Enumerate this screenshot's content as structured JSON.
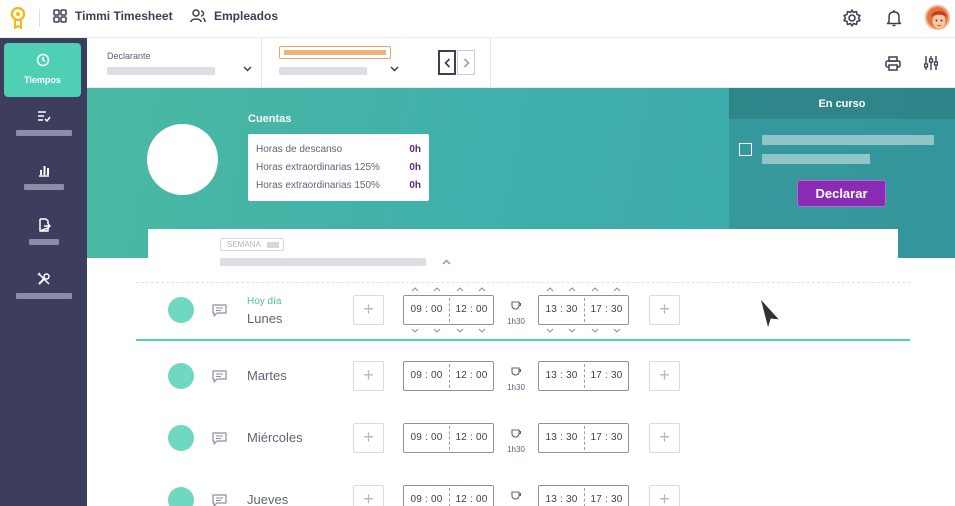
{
  "topbar": {
    "app_name": "Timmi Timesheet",
    "employees_label": "Empleados"
  },
  "sidebar": {
    "items": [
      {
        "label": "Tiempos",
        "icon": "clock-icon",
        "active": true
      },
      {
        "label": "",
        "icon": "list-check-icon"
      },
      {
        "label": "",
        "icon": "bar-chart-icon"
      },
      {
        "label": "",
        "icon": "document-export-icon"
      },
      {
        "label": "",
        "icon": "tools-icon"
      }
    ]
  },
  "filters": {
    "declarante_label": "Declarante"
  },
  "summary": {
    "cuentas_title": "Cuentas",
    "rows": [
      {
        "label": "Horas de descanso",
        "value": "0h"
      },
      {
        "label": "Horas extraordinarias 125%",
        "value": "0h"
      },
      {
        "label": "Horas extraordinarias 150%",
        "value": "0h"
      }
    ]
  },
  "en_curso": {
    "title": "En curso",
    "declare_button": "Declarar"
  },
  "week": {
    "semana_tag": "SEMANA",
    "days": [
      {
        "hoy": "Hoy día",
        "name": "Lunes",
        "am_start": "09 : 00",
        "am_end": "12 : 00",
        "break": "1h30",
        "pm_start": "13 : 30",
        "pm_end": "17 : 30"
      },
      {
        "hoy": "",
        "name": "Martes",
        "am_start": "09 : 00",
        "am_end": "12 : 00",
        "break": "1h30",
        "pm_start": "13 : 30",
        "pm_end": "17 : 30"
      },
      {
        "hoy": "",
        "name": "Miércoles",
        "am_start": "09 : 00",
        "am_end": "12 : 00",
        "break": "1h30",
        "pm_start": "13 : 30",
        "pm_end": "17 : 30"
      },
      {
        "hoy": "",
        "name": "Jueves",
        "am_start": "09 : 00",
        "am_end": "12 : 00",
        "break": "1h30",
        "pm_start": "13 : 30",
        "pm_end": "17 : 30"
      }
    ]
  },
  "colors": {
    "sidebar": "#3d3e5e",
    "accent": "#4fcfb3",
    "band": "#3fb0ab",
    "declare": "#8b2bb5"
  }
}
